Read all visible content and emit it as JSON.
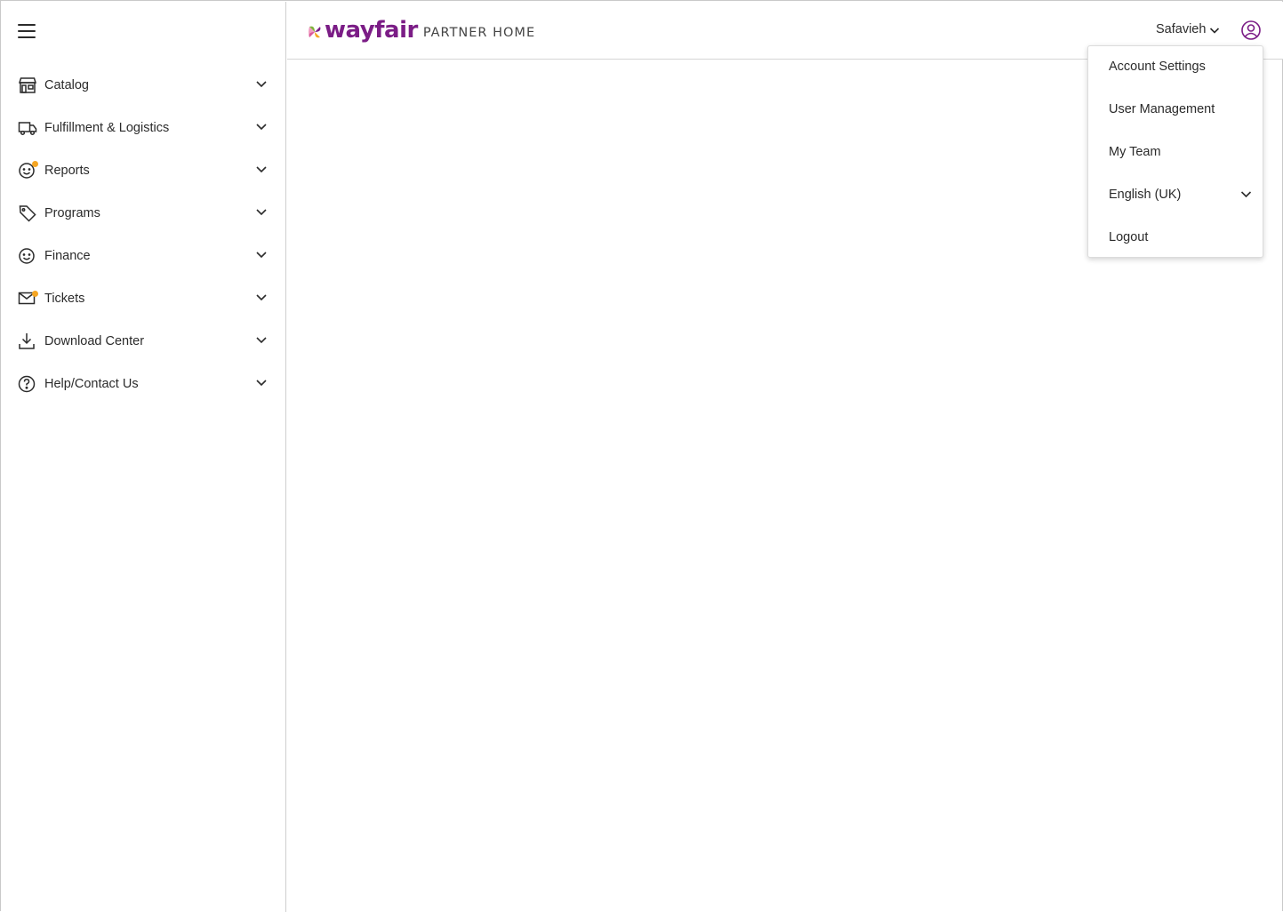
{
  "sidebar": {
    "menu_icon": "hamburger-icon",
    "items": [
      {
        "label": "Catalog",
        "icon": "store-icon",
        "badge": false
      },
      {
        "label": "Fulfillment & Logistics",
        "icon": "truck-icon",
        "badge": false
      },
      {
        "label": "Reports",
        "icon": "smiley-chart-icon",
        "badge": true
      },
      {
        "label": "Programs",
        "icon": "tag-icon",
        "badge": false
      },
      {
        "label": "Finance",
        "icon": "smiley-icon",
        "badge": false
      },
      {
        "label": "Tickets",
        "icon": "mail-icon",
        "badge": true
      },
      {
        "label": "Download Center",
        "icon": "download-icon",
        "badge": false
      },
      {
        "label": "Help/Contact Us",
        "icon": "help-circle-icon",
        "badge": false
      }
    ]
  },
  "header": {
    "logo_word": "wayfair",
    "logo_sub": "PARTNER HOME",
    "account_name": "Safavieh",
    "profile_icon": "user-circle-icon"
  },
  "account_menu": {
    "items": [
      {
        "label": "Account Settings"
      },
      {
        "label": "User Management"
      },
      {
        "label": "My Team"
      },
      {
        "label": "English (UK)",
        "has_chevron": true
      },
      {
        "label": "Logout"
      }
    ]
  },
  "colors": {
    "brand": "#7b1d86",
    "badge": "#f5a623",
    "text": "#2b2b2b"
  }
}
